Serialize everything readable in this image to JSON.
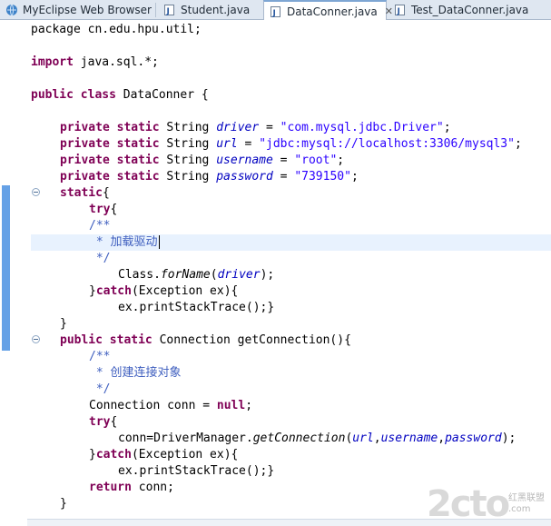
{
  "tabs": [
    {
      "label": "MyEclipse Web Browser",
      "icon": "globe-icon",
      "active": false
    },
    {
      "label": "Student.java",
      "icon": "java-file-icon",
      "active": false
    },
    {
      "label": "DataConner.java",
      "icon": "java-file-icon",
      "active": true,
      "close": "✕"
    },
    {
      "label": "Test_DataConner.java",
      "icon": "java-file-icon",
      "active": false
    }
  ],
  "code": {
    "l1": "package cn.edu.hpu.util;",
    "l3_kw": "import",
    "l3_rest": " java.sql.*;",
    "l5_kw1": "public",
    "l5_kw2": "class",
    "l5_rest": " DataConner {",
    "l7_name": "driver",
    "l7_val": "\"com.mysql.jdbc.Driver\"",
    "l8_name": "url",
    "l8_val": "\"jdbc:mysql://localhost:3306/mysql3\"",
    "l9_name": "username",
    "l9_val": "\"root\"",
    "l10_name": "password",
    "l10_val": "\"739150\"",
    "kw_private": "private",
    "kw_static": "static",
    "type_string": " String ",
    "static_block": "static",
    "kw_try": "try",
    "doc_open": "/**",
    "doc1_star": " * ",
    "doc1_text": "加载驱动",
    "doc_close": " */",
    "forname_pre": "Class.",
    "forname_m": "forName",
    "forname_arg": "driver",
    "kw_catch": "catch",
    "catch_rest": "(Exception ex){",
    "print_trace": "ex.printStackTrace();}",
    "get_conn": " Connection getConnection(){",
    "doc2_text": "创建连接对象",
    "conn_decl": "Connection conn = ",
    "kw_null": "null",
    "dm_pre": "conn=DriverManager.",
    "dm_m": "getConnection",
    "a_url": "url",
    "a_user": "username",
    "a_pass": "password",
    "kw_return": "return",
    "return_rest": " conn;"
  },
  "watermark": {
    "main": "2cto",
    "sub1": "红黑联盟",
    "sub2": ".com"
  },
  "colors": {
    "keyword": "#7f0055",
    "string": "#2a00ff",
    "field": "#0000c0",
    "comment": "#3f5fbf",
    "current_line": "#e8f2fe"
  }
}
